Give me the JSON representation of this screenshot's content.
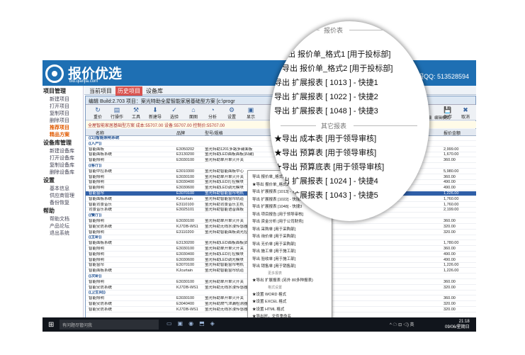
{
  "app": {
    "name": "报价优选",
    "url": "bid.qianjia.com",
    "qq": "客服QQ: 513528594"
  },
  "sidebar": [
    {
      "label": "项目管理",
      "items": [
        "新建项目",
        "打开项目",
        "复制项目",
        "删除项目",
        "推荐项目",
        "精品方案"
      ]
    },
    {
      "label": "设备库管理",
      "items": [
        "新建设备库",
        "打开设备库",
        "复制设备库",
        "删除设备库"
      ]
    },
    {
      "label": "设置",
      "items": [
        "基本信息",
        "供应商管理",
        "备份恢复"
      ]
    },
    {
      "label": "帮助",
      "items": [
        "帮助文档",
        "产品论坛",
        "退出系统"
      ]
    }
  ],
  "tabs": [
    "当前项目",
    "历史项目",
    "设备库"
  ],
  "window_title": "编辑  Build:2.703  项目：案光特助全屋智能家居基础型方案  [c:\\progr",
  "toolbar": [
    {
      "icon": "↻",
      "label": "重价"
    },
    {
      "icon": "▤",
      "label": "行操作"
    },
    {
      "icon": "⚒",
      "label": "工具"
    },
    {
      "icon": "⬇",
      "label": "新建导入"
    },
    {
      "icon": "✓",
      "label": "选验"
    },
    {
      "icon": "⌂",
      "label": "面图"
    },
    {
      "icon": "◔",
      "label": "分析"
    },
    {
      "icon": "⚙",
      "label": "设置"
    },
    {
      "icon": "▣",
      "label": "显示"
    }
  ],
  "toolbar_right": [
    {
      "icon": "💾",
      "label": "保存"
    },
    {
      "icon": "✖",
      "label": "取消"
    }
  ],
  "infobar": "全屋智能家居基础型方案    成本:55707.00  设备:55707.00  控制价:55707.00",
  "grid_headers": [
    "名称",
    "品牌",
    "型号/规格"
  ],
  "grid_right_header": "报价金额",
  "checkboxes": {
    "show_details": "显示明细",
    "arrange": "编辑模式"
  },
  "rows": [
    {
      "name": "((1))智能照明系统",
      "brand": "",
      "model": "",
      "price": "",
      "type": "grp"
    },
    {
      "name": "((入户))",
      "brand": "",
      "model": "",
      "price": "",
      "type": "grp"
    },
    {
      "name": "智能面板",
      "brand": "E3050202",
      "model": "萤光特助1201多路多键面板",
      "price": "2,999.00",
      "type": "n"
    },
    {
      "name": "智能面板系统",
      "brand": "E3130200",
      "model": "萤光特助LED面板面板(四键)",
      "price": "1,670.00",
      "type": "n"
    },
    {
      "name": "智能照明",
      "brand": "E3030100",
      "model": "萤光特助单开单火开关",
      "price": "360.00",
      "type": "n"
    },
    {
      "name": "((客厅))",
      "brand": "",
      "model": "",
      "price": "",
      "type": "grp"
    },
    {
      "name": "智能中控系统",
      "brand": "E3010300",
      "model": "萤光特助智能面板中心",
      "price": "5,980.00",
      "type": "n"
    },
    {
      "name": "智能照明",
      "brand": "E3030100",
      "model": "萤光特助单开单火开关",
      "price": "360.00",
      "type": "n"
    },
    {
      "name": "智能照明",
      "brand": "E3030400",
      "model": "萤光特助LED灯控模块",
      "price": "490.00",
      "type": "n"
    },
    {
      "name": "智能照明",
      "brand": "E3030600",
      "model": "萤光特助LED调光模块",
      "price": "490.00",
      "type": "n"
    },
    {
      "name": "智能窗帘",
      "brand": "E3070100",
      "model": "萤光特助智能窗帘电机",
      "price": "1,226.00",
      "type": "hl"
    },
    {
      "name": "智能面板系统",
      "brand": "KJcurtain",
      "model": "萤光特助智能窗帘轨道",
      "price": "1,760.00",
      "type": "n"
    },
    {
      "name": "智能背景音乐",
      "brand": "E3110100",
      "model": "萤光特助背景音乐主机",
      "price": "1,760.00",
      "type": "n"
    },
    {
      "name": "背景音乐系统",
      "brand": "E3025101",
      "model": "萤光特助智能语音面板",
      "price": "2,199.00",
      "type": "n"
    },
    {
      "name": "((餐厅))",
      "brand": "",
      "model": "",
      "price": "",
      "type": "grp"
    },
    {
      "name": "智能照明",
      "brand": "E3030100",
      "model": "萤光特助单开单火开关",
      "price": "360.00",
      "type": "n"
    },
    {
      "name": "智能安防系统",
      "brand": "KJ7DB-WS1",
      "model": "萤光特助无线水浸传感器",
      "price": "320.00",
      "type": "n"
    },
    {
      "name": "智能照明",
      "brand": "E3110200",
      "model": "萤光特助智能面板调光控制",
      "price": "320.00",
      "type": "n"
    },
    {
      "name": "((主卧))",
      "brand": "",
      "model": "",
      "price": "",
      "type": "grp"
    },
    {
      "name": "智能面板系统",
      "brand": "E3130200",
      "model": "萤光特助LED面板面板(四键)",
      "price": "1,780.00",
      "type": "n"
    },
    {
      "name": "智能照明",
      "brand": "E3030100",
      "model": "萤光特助单开单火开关",
      "price": "360.00",
      "type": "n"
    },
    {
      "name": "智能照明",
      "brand": "E3030400",
      "model": "萤光特助LED灯控模块",
      "price": "490.00",
      "type": "n"
    },
    {
      "name": "智能照明",
      "brand": "E3030600",
      "model": "萤光特助LED调光模块",
      "price": "490.00",
      "type": "n"
    },
    {
      "name": "智能窗帘",
      "brand": "E3070100",
      "model": "萤光特助智能窗帘电机",
      "price": "1,226.00",
      "type": "n"
    },
    {
      "name": "智能面板系统",
      "brand": "KJcurtain",
      "model": "萤光特助智能窗帘轨道",
      "price": "1,226.00",
      "type": "n"
    },
    {
      "name": "((次卧))",
      "brand": "",
      "model": "",
      "price": "",
      "type": "grp"
    },
    {
      "name": "智能照明",
      "brand": "E3030100",
      "model": "萤光特助单开单火开关",
      "price": "360.00",
      "type": "n"
    },
    {
      "name": "智能安防系统",
      "brand": "KJ7DB-WS1",
      "model": "萤光特助无线水浸传感器",
      "price": "320.00",
      "type": "n"
    },
    {
      "name": "((卫生间))",
      "brand": "",
      "model": "",
      "price": "",
      "type": "grp"
    },
    {
      "name": "智能照明",
      "brand": "E3030100",
      "model": "萤光特助单开单火开关",
      "price": "360.00",
      "type": "n"
    },
    {
      "name": "智能安防系统",
      "brand": "E3040400",
      "model": "萤光特助燃气泄漏检测器",
      "price": "320.00",
      "type": "n"
    },
    {
      "name": "智能安防系统",
      "brand": "KJ7DB-WS1",
      "model": "萤光特助无线水浸传感器",
      "price": "320.00",
      "type": "n"
    }
  ],
  "context_menu": {
    "items": [
      "导出 报价单_格式1 [用于投标部]",
      "★导出 报价单_格式2 [用于投标部]",
      "导出 扩展报表 [1013] - 快捷1",
      "导出 扩展报表 [1022] - 快捷2",
      "导出 扩展报表 [1048] - 快捷3",
      "导出 项目报告 [用于领导审核]",
      "导出 资金分析 [用于公司财务]",
      "导出 采购单 [用于采购部]",
      "导出 询价单 [用于采购部]",
      "导出 无价单 [用于采购部]",
      "导出 施工单 [用于施工部]",
      "导出 验收单 [用于施工部]",
      "导出 销售单 [用于销售部]"
    ],
    "sep_more": "更多报表",
    "item_more": "★导出 扩展报表 (另外 80多种报表)",
    "sep_format": "格式设置",
    "format_items": [
      "★设置 WORD 格式",
      "★设置 EXCEL 格式",
      "★设置 HTML 格式",
      "★导出时，文件重命名"
    ],
    "last": "★导出项目原文件 - > 目录"
  },
  "magnifier": {
    "sep_top": "报价表",
    "items_top": [
      "导出 报价单_格式1 [用于投标部]",
      "★导出 报价单_格式2 [用于投标部]",
      "导出 扩展报表 [ 1013 ] - 快捷1",
      "导出 扩展报表 [ 1022 ] - 快捷2",
      "导出 扩展报表 [ 1048 ] - 快捷3"
    ],
    "sep_other": "其它报表",
    "items_other": [
      "★导出 成本表 [用于领导审核]",
      "★导出 预算表 [用于领导审核]",
      "★导出 预算底表 [用于领导审核]",
      "导出 扩展报表 [ 1024 ] - 快捷4",
      "导出 扩展报表 [ 1043 ] - 快捷5"
    ]
  },
  "taskbar": {
    "search_placeholder": "有问题尽管问我",
    "clock_time": "21:18",
    "clock_date": "09/06/星期日",
    "tray": "^ ☁ ⊡ ◁) 英"
  },
  "colors": {
    "brand_blue": "#1e6fb3",
    "tab_active": "#d9534f",
    "highlight_row": "#2f5fa8"
  }
}
